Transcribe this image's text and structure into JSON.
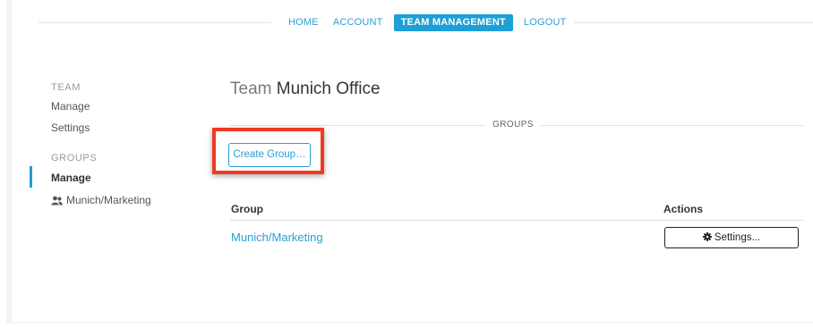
{
  "nav": {
    "items": [
      {
        "label": "HOME",
        "active": false
      },
      {
        "label": "ACCOUNT",
        "active": false
      },
      {
        "label": "TEAM MANAGEMENT",
        "active": true
      },
      {
        "label": "LOGOUT",
        "active": false
      }
    ]
  },
  "sidebar": {
    "team_heading": "TEAM",
    "team_items": [
      "Manage",
      "Settings"
    ],
    "groups_heading": "GROUPS",
    "groups_items": [
      {
        "label": "Manage",
        "icon": null,
        "selected": true
      },
      {
        "label": "Munich/Marketing",
        "icon": "users-icon",
        "selected": false
      }
    ]
  },
  "main": {
    "title_prefix": "Team",
    "title_name": "Munich Office",
    "section_label": "GROUPS",
    "create_button": "Create Group…",
    "table": {
      "columns": [
        "Group",
        "Actions"
      ],
      "rows": [
        {
          "group": "Munich/Marketing",
          "action_label": "Settings...",
          "action_icon": "gear-icon"
        }
      ]
    }
  },
  "colors": {
    "accent": "#1e9fd6",
    "highlight": "#ee3a22"
  }
}
